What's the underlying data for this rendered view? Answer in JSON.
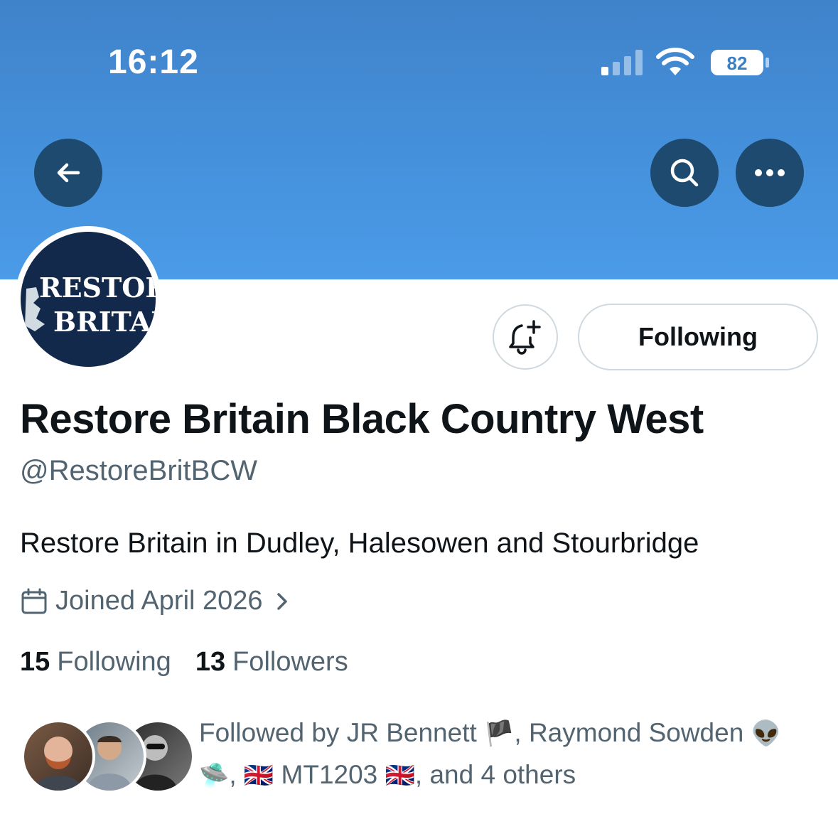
{
  "status_bar": {
    "time": "16:12",
    "battery": "82"
  },
  "avatar": {
    "line1": "RESTORE",
    "line2": "BRITAIN"
  },
  "actions": {
    "follow_state": "Following"
  },
  "profile": {
    "display_name": "Restore Britain Black Country West",
    "handle": "@RestoreBritBCW",
    "bio": "Restore Britain in Dudley, Halesowen and Stourbridge",
    "joined": "Joined April 2026"
  },
  "stats": {
    "following_count": "15",
    "following_label": "Following",
    "followers_count": "13",
    "followers_label": "Followers"
  },
  "followed_by": {
    "prefix": "Followed by JR Bennett",
    "flag1": "🏴",
    "name2": ", Raymond Sowden",
    "emoji_a": "👽",
    "emoji_b": "🛸",
    "sep": ",",
    "flag_uk": "🇬🇧",
    "name3": "MT1203",
    "flag_uk2": "🇬🇧",
    "suffix": ", and 4 others"
  },
  "colors": {
    "banner": "#4a9be8",
    "button_dark": "#1e4a70",
    "avatar_bg": "#13294b",
    "secondary_text": "#536471"
  }
}
